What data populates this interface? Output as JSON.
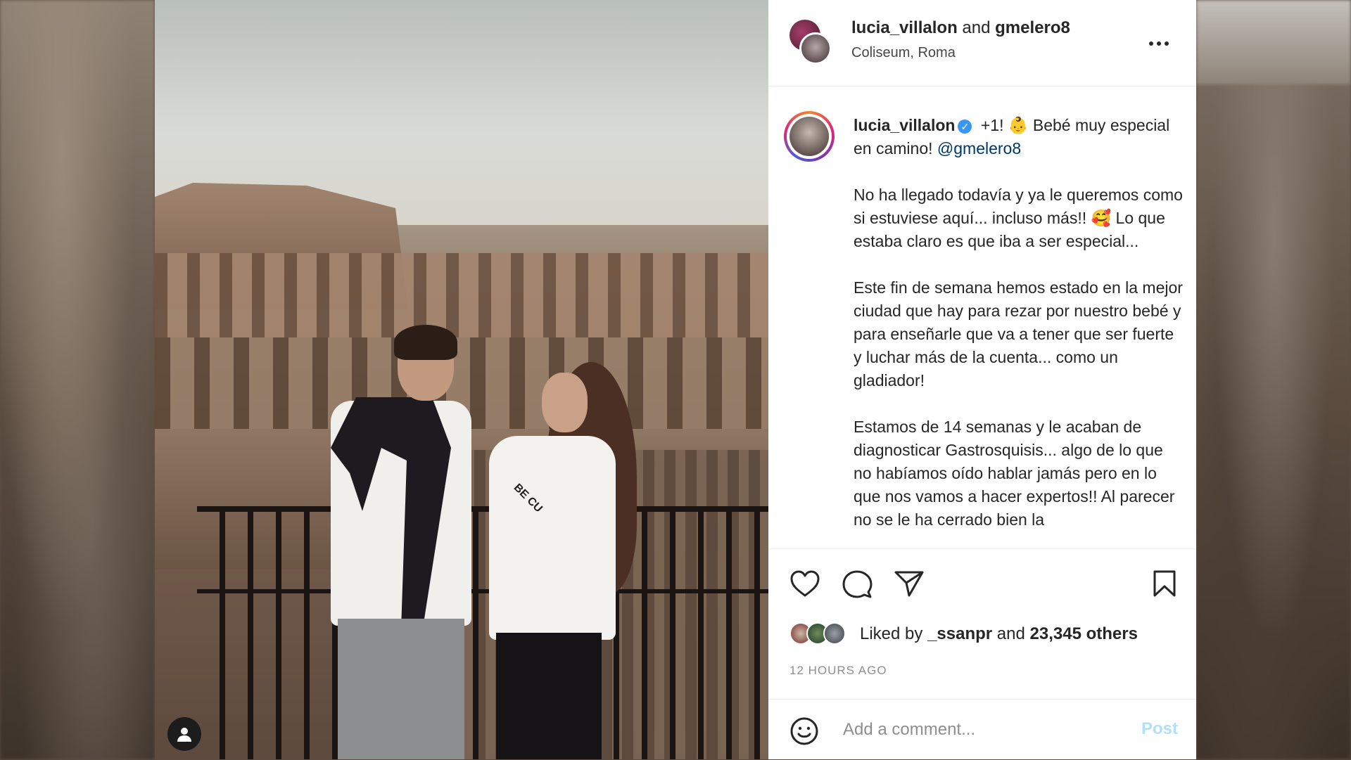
{
  "post": {
    "owner": "lucia_villalon",
    "and_word": "and",
    "collaborator": "gmelero8",
    "location": "Coliseum, Roma",
    "more_icon": "more-horizontal-icon"
  },
  "photo": {
    "shirt_text": "BE CU"
  },
  "caption": {
    "username": "lucia_villalon",
    "verified_icon": "verified-badge-icon",
    "lines": [
      "+1! 👶 Bebé muy especial en camino!",
      "No ha llegado todavía y ya le queremos como si estuviese aquí... incluso más!! 🥰 Lo que estaba claro es que iba a ser especial...",
      "Este fin de semana hemos estado en la mejor ciudad que hay para rezar por nuestro bebé y para enseñarle que va a tener que ser fuerte y luchar más de la cuenta... como un gladiador!",
      "Estamos de 14 semanas y le acaban de diagnosticar Gastrosquisis... algo de lo que no habíamos oído hablar jamás pero en lo que nos vamos a hacer expertos!! Al parecer no se le ha cerrado bien la"
    ],
    "mention": "@gmelero8"
  },
  "actions": {
    "like_icon": "heart-icon",
    "comment_icon": "comment-icon",
    "share_icon": "send-icon",
    "save_icon": "bookmark-icon"
  },
  "likes": {
    "prefix": "Liked by",
    "first_user": "_ssanpr",
    "and_word": "and",
    "others": "23,345 others"
  },
  "timestamp": "12 HOURS AGO",
  "comment": {
    "placeholder": "Add a comment...",
    "post_label": "Post",
    "emoji_icon": "emoji-icon"
  },
  "colors": {
    "accent_blue": "#3897f0",
    "post_disabled": "#b2dffc",
    "mention": "#00376b"
  }
}
